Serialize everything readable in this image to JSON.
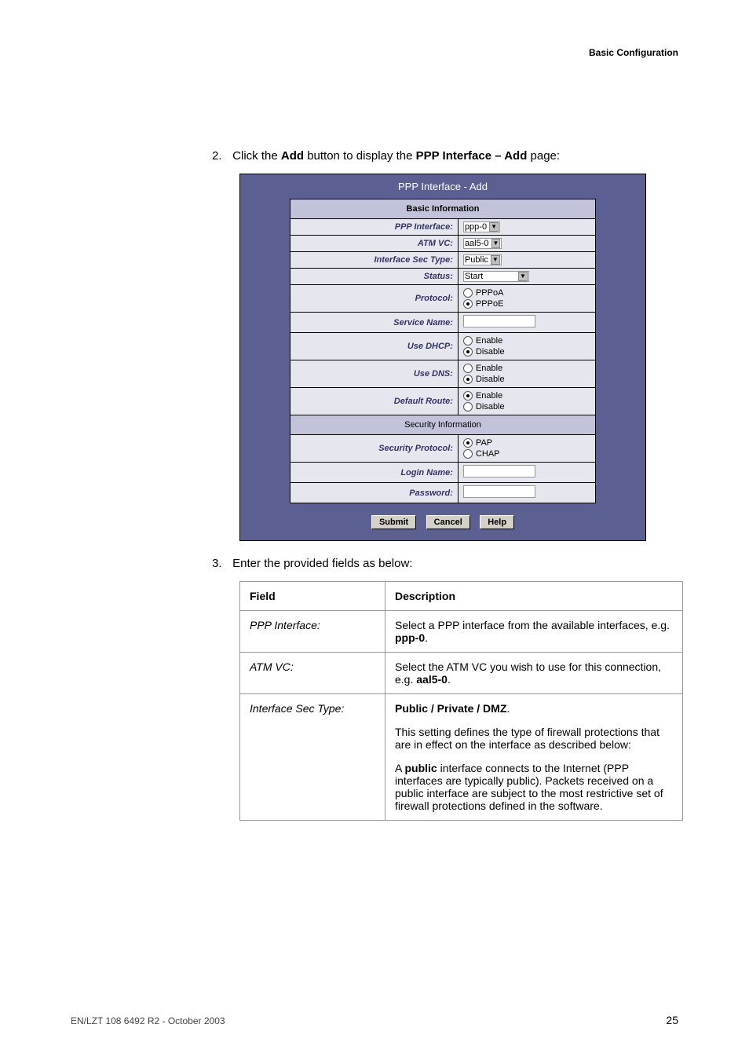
{
  "header": {
    "section_title": "Basic Configuration"
  },
  "steps": {
    "s2_num": "2.",
    "s2_pre": "Click the ",
    "s2_b1": "Add",
    "s2_mid": " button to display the ",
    "s2_b2": "PPP Interface – Add",
    "s2_post": " page:",
    "s3_num": "3.",
    "s3_text": "Enter the provided fields as below:"
  },
  "screenshot": {
    "title": "PPP Interface - Add",
    "section_basic": "Basic Information",
    "section_security": "Security Information",
    "rows": {
      "ppp_interface": {
        "label": "PPP Interface:",
        "value": "ppp-0"
      },
      "atm_vc": {
        "label": "ATM VC:",
        "value": "aal5-0"
      },
      "if_sec": {
        "label": "Interface Sec Type:",
        "value": "Public"
      },
      "status": {
        "label": "Status:",
        "value": "Start"
      },
      "protocol": {
        "label": "Protocol:",
        "opt1": "PPPoA",
        "opt2": "PPPoE",
        "selected": "PPPoE"
      },
      "service_name": {
        "label": "Service Name:",
        "value": ""
      },
      "use_dhcp": {
        "label": "Use DHCP:",
        "opt1": "Enable",
        "opt2": "Disable",
        "selected": "Disable"
      },
      "use_dns": {
        "label": "Use DNS:",
        "opt1": "Enable",
        "opt2": "Disable",
        "selected": "Disable"
      },
      "default_route": {
        "label": "Default Route:",
        "opt1": "Enable",
        "opt2": "Disable",
        "selected": "Enable"
      },
      "sec_protocol": {
        "label": "Security Protocol:",
        "opt1": "PAP",
        "opt2": "CHAP",
        "selected": "PAP"
      },
      "login_name": {
        "label": "Login Name:",
        "value": ""
      },
      "password": {
        "label": "Password:",
        "value": ""
      }
    },
    "buttons": {
      "submit": "Submit",
      "cancel": "Cancel",
      "help": "Help"
    }
  },
  "table": {
    "head_field": "Field",
    "head_desc": "Description",
    "rows": [
      {
        "field": "PPP Interface:",
        "desc_pre": "Select a PPP interface from the available interfaces, e.g. ",
        "desc_bold": "ppp-0",
        "desc_post": "."
      },
      {
        "field": "ATM VC:",
        "desc_pre": "Select the ATM VC you wish to use for this connection, e.g. ",
        "desc_bold": "aal5-0",
        "desc_post": "."
      },
      {
        "field": "Interface Sec Type:",
        "p1_bold": "Public / Private / DMZ",
        "p1_post": ".",
        "p2": "This setting defines the type of firewall protections that are in effect on the interface as described below:",
        "p3_pre": "A ",
        "p3_bold": "public",
        "p3_post": " interface connects to the Internet (PPP interfaces are typically public). Packets received on a public interface are subject to the most restrictive set of firewall protections defined in the software."
      }
    ]
  },
  "footer": {
    "left": "EN/LZT 108 6492 R2 - October 2003",
    "right": "25"
  }
}
